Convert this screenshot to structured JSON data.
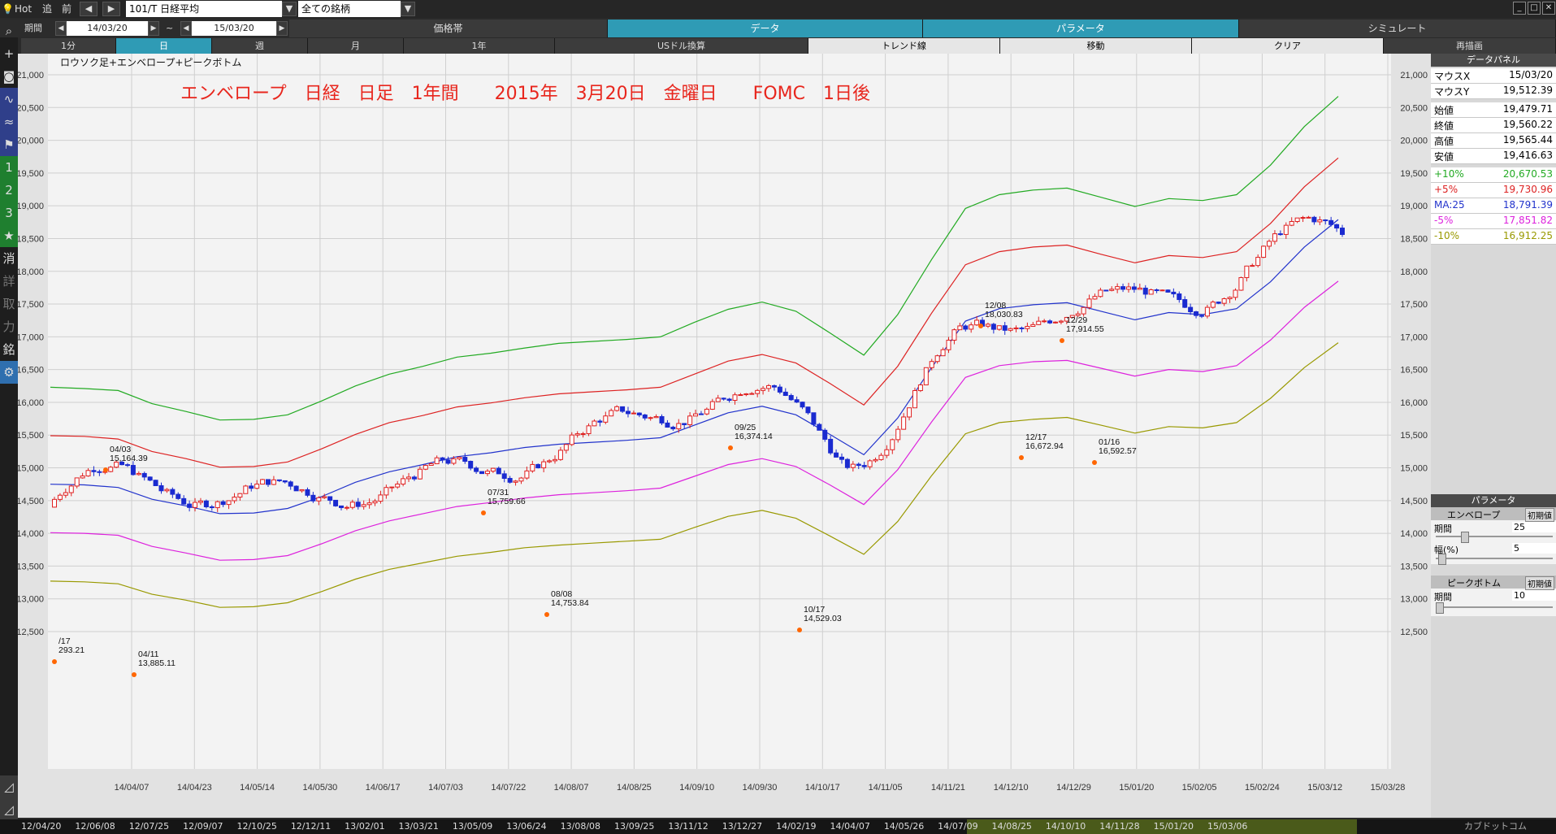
{
  "topbar": {
    "hot": "Hot",
    "tsui": "追",
    "mae": "前",
    "symbol": "101/T 日経平均",
    "filter": "全ての銘柄"
  },
  "row2": {
    "period_label": "期間",
    "start": "14/03/20",
    "tilde": "~",
    "end": "15/03/20",
    "tabs": [
      "価格帯",
      "データ",
      "パラメータ",
      "シミュレート"
    ]
  },
  "row3": {
    "buttons": [
      "1分",
      "日",
      "週",
      "月",
      "1年",
      "USドル換算",
      "トレンド線",
      "移動",
      "クリア",
      "再描画"
    ]
  },
  "lefttb": {
    "n1": "1",
    "n2": "2",
    "n3": "3",
    "star": "★",
    "k1": "消",
    "k2": "詳",
    "k3": "取",
    "k4": "力",
    "k5": "銘"
  },
  "chart": {
    "subtitle": "ロウソク足+エンベロープ+ピークボトム",
    "headline": "エンベロープ　日経　日足　1年間　　2015年　3月20日　金曜日　　FOMC　1日後"
  },
  "chart_data": {
    "type": "candlestick",
    "ylim": [
      12000,
      21500
    ],
    "yticks": [
      "21,000",
      "20,500",
      "20,000",
      "19,500",
      "19,000",
      "18,500",
      "18,000",
      "17,500",
      "17,000",
      "16,500",
      "16,000",
      "15,500",
      "15,000",
      "14,500",
      "14,000",
      "13,500",
      "13,000",
      "12,500"
    ],
    "xtick_labels": [
      "14/04/07",
      "14/04/23",
      "14/05/14",
      "14/05/30",
      "14/06/17",
      "14/07/03",
      "14/07/22",
      "14/08/07",
      "14/08/25",
      "14/09/10",
      "14/09/30",
      "14/10/17",
      "14/11/05",
      "14/11/21",
      "14/12/10",
      "14/12/29",
      "15/01/20",
      "15/02/05",
      "15/02/24",
      "15/03/12",
      "15/03/28"
    ],
    "series": [
      {
        "name": "+10%",
        "color": "#22aa22",
        "values": [
          16230,
          16210,
          16180,
          15980,
          15860,
          15730,
          15740,
          15810,
          16020,
          16250,
          16430,
          16550,
          16690,
          16750,
          16830,
          16900,
          16930,
          16960,
          17000,
          17220,
          17420,
          17530,
          17390,
          17060,
          16720,
          17340,
          18180,
          18960,
          19170,
          19240,
          19270,
          19130,
          18990,
          19110,
          19080,
          19170,
          19620,
          20210,
          20670
        ]
      },
      {
        "name": "+5%",
        "color": "#dd2222",
        "values": [
          15490,
          15480,
          15440,
          15250,
          15140,
          15010,
          15020,
          15090,
          15290,
          15510,
          15690,
          15800,
          15930,
          15990,
          16070,
          16130,
          16160,
          16190,
          16230,
          16430,
          16630,
          16730,
          16600,
          16290,
          15960,
          16550,
          17360,
          18100,
          18300,
          18370,
          18400,
          18260,
          18130,
          18240,
          18210,
          18300,
          18730,
          19290,
          19730
        ]
      },
      {
        "name": "MA:25",
        "color": "#2233cc",
        "values": [
          14750,
          14740,
          14700,
          14520,
          14420,
          14300,
          14310,
          14380,
          14560,
          14780,
          14940,
          15050,
          15170,
          15230,
          15310,
          15360,
          15390,
          15420,
          15460,
          15650,
          15840,
          15940,
          15810,
          15510,
          15200,
          15760,
          16530,
          17240,
          17430,
          17490,
          17520,
          17390,
          17260,
          17370,
          17340,
          17430,
          17840,
          18370,
          18790
        ]
      },
      {
        "name": "-5%",
        "color": "#dd22dd",
        "values": [
          14010,
          14000,
          13970,
          13800,
          13700,
          13590,
          13600,
          13660,
          13840,
          14040,
          14190,
          14300,
          14410,
          14470,
          14540,
          14590,
          14620,
          14650,
          14690,
          14870,
          15050,
          15140,
          15020,
          14740,
          14440,
          14970,
          15700,
          16380,
          16560,
          16620,
          16640,
          16520,
          16400,
          16500,
          16470,
          16560,
          16950,
          17450,
          17850
        ]
      },
      {
        "name": "-10%",
        "color": "#999900",
        "values": [
          13270,
          13260,
          13230,
          13070,
          12980,
          12870,
          12880,
          12940,
          13110,
          13300,
          13450,
          13550,
          13650,
          13710,
          13780,
          13820,
          13850,
          13880,
          13910,
          14090,
          14260,
          14350,
          14230,
          13960,
          13680,
          14180,
          14880,
          15520,
          15690,
          15740,
          15770,
          15650,
          15530,
          15630,
          15610,
          15690,
          16060,
          16530,
          16910
        ]
      }
    ],
    "annotations": [
      {
        "date": "04/03",
        "value": "15,164.39"
      },
      {
        "date": "04/11",
        "value": "13,885.11"
      },
      {
        "date": "07/31",
        "value": "15,759.66"
      },
      {
        "date": "08/08",
        "value": "14,753.84"
      },
      {
        "date": "09/25",
        "value": "16,374.14"
      },
      {
        "date": "10/17",
        "value": "14,529.03"
      },
      {
        "date": "12/08",
        "value": "18,030.83"
      },
      {
        "date": "12/17",
        "value": "16,672.94"
      },
      {
        "date": "12/29",
        "value": "17,914.55"
      },
      {
        "date": "01/16",
        "value": "16,592.57"
      },
      {
        "date": "/17",
        "value": "293.21"
      }
    ]
  },
  "bottom": {
    "dates": [
      "12/04/20",
      "12/06/08",
      "12/07/25",
      "12/09/07",
      "12/10/25",
      "12/12/11",
      "13/02/01",
      "13/03/21",
      "13/05/09",
      "13/06/24",
      "13/08/08",
      "13/09/25",
      "13/11/12",
      "13/12/27",
      "14/02/19",
      "14/04/07",
      "14/05/26",
      "14/07/09",
      "14/08/25",
      "14/10/10",
      "14/11/28",
      "15/01/20",
      "15/03/06"
    ]
  },
  "rpanel": {
    "title": "データパネル",
    "rows": [
      {
        "k": "マウスX",
        "v": "15/03/20",
        "color": "#000000"
      },
      {
        "k": "マウスY",
        "v": "19,512.39",
        "color": "#000000"
      },
      {
        "k": "始値",
        "v": "19,479.71",
        "color": "#000000"
      },
      {
        "k": "終値",
        "v": "19,560.22",
        "color": "#000000"
      },
      {
        "k": "高値",
        "v": "19,565.44",
        "color": "#000000"
      },
      {
        "k": "安値",
        "v": "19,416.63",
        "color": "#000000"
      },
      {
        "k": "+10%",
        "v": "20,670.53",
        "color": "#22aa22"
      },
      {
        "k": "+5%",
        "v": "19,730.96",
        "color": "#dd2222"
      },
      {
        "k": "MA:25",
        "v": "18,791.39",
        "color": "#2233cc"
      },
      {
        "k": "-5%",
        "v": "17,851.82",
        "color": "#dd22dd"
      },
      {
        "k": "-10%",
        "v": "16,912.25",
        "color": "#999900"
      }
    ],
    "params_title": "パラメータ",
    "env_label": "エンベロープ",
    "init_btn": "初期値",
    "period_label": "期間",
    "period_val": "25",
    "width_label": "幅(%)",
    "width_val": "5",
    "pb_label": "ピークボトム",
    "pb_init": "初期値",
    "pb_period_label": "期間",
    "pb_period_val": "10"
  }
}
